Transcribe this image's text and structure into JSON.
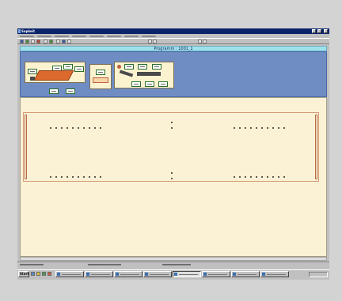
{
  "window": {
    "title": "Sapkeit",
    "app_icon": "app-window-icon",
    "buttons": [
      "minimize-icon",
      "maximize-icon",
      "close-icon"
    ]
  },
  "menu": {
    "item_count": 8
  },
  "header": {
    "program_label": "Programm : 1001_1"
  },
  "taskbar": {
    "start_label": "Start",
    "start_icon": "windows-logo-icon",
    "task_count": 8,
    "active_task_index": 4
  },
  "colors": {
    "program_bar": "#9fe1ec",
    "station_panel": "#6f8dc2",
    "work_area": "#fbf2d6",
    "title_bar": "#0a246a"
  }
}
